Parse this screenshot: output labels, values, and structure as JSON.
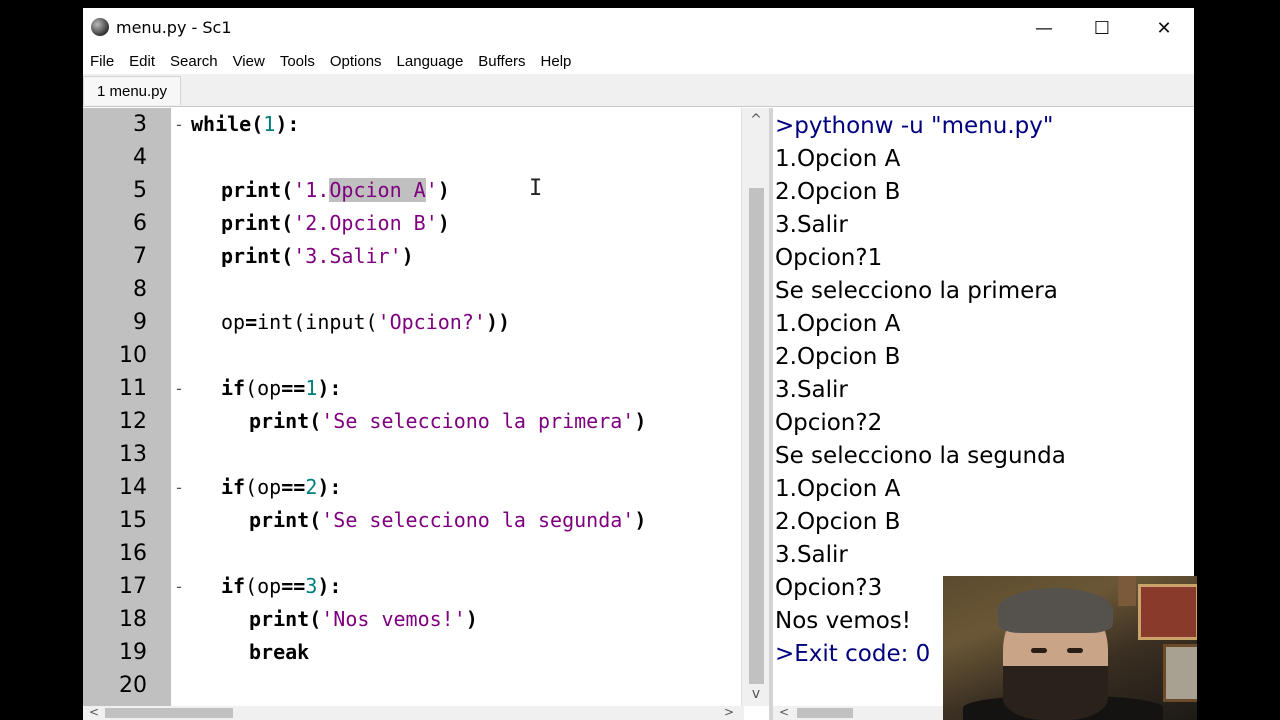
{
  "window": {
    "title": "menu.py - Sc1",
    "minimize_label": "—",
    "maximize_label": "☐",
    "close_label": "✕"
  },
  "menus": [
    "File",
    "Edit",
    "Search",
    "View",
    "Tools",
    "Options",
    "Language",
    "Buffers",
    "Help"
  ],
  "tab": {
    "label": "1 menu.py"
  },
  "editor": {
    "line_numbers": [
      "3",
      "4",
      "5",
      "6",
      "7",
      "8",
      "9",
      "10",
      "11",
      "12",
      "13",
      "14",
      "15",
      "16",
      "17",
      "18",
      "19",
      "20"
    ],
    "code": {
      "l3_kw": "while",
      "l3_open": "(",
      "l3_num": "1",
      "l3_close": "):",
      "print_kw": "print",
      "l5_open": "(",
      "l5_str_a": "'1.",
      "l5_str_sel": "Opcion A",
      "l5_str_b": "'",
      "l5_close": ")",
      "l6_str": "'2.Opcion B'",
      "l7_str": "'3.Salir'",
      "l9_a": "op",
      "l9_eq": "=",
      "l9_b": "int(input(",
      "l9_str": "'Opcion?'",
      "l9_c": "))",
      "if_kw": "if",
      "if_open": "(op",
      "if_eqeq": "==",
      "if_close": "):",
      "n1": "1",
      "n2": "2",
      "n3": "3",
      "l12_str": "'Se selecciono la primera'",
      "l15_str": "'Se selecciono la segunda'",
      "l18_str": "'Nos vemos!'",
      "break_kw": "break",
      "paren_open": "(",
      "paren_close": ")"
    }
  },
  "output": {
    "lines": [
      ">pythonw -u \"menu.py\"",
      "1.Opcion A",
      "2.Opcion B",
      "3.Salir",
      "Opcion?1",
      "Se selecciono la primera",
      "1.Opcion A",
      "2.Opcion B",
      "3.Salir",
      "Opcion?2",
      "Se selecciono la segunda",
      "1.Opcion A",
      "2.Opcion B",
      "3.Salir",
      "Opcion?3",
      "Nos vemos!",
      ">Exit code: 0"
    ]
  }
}
